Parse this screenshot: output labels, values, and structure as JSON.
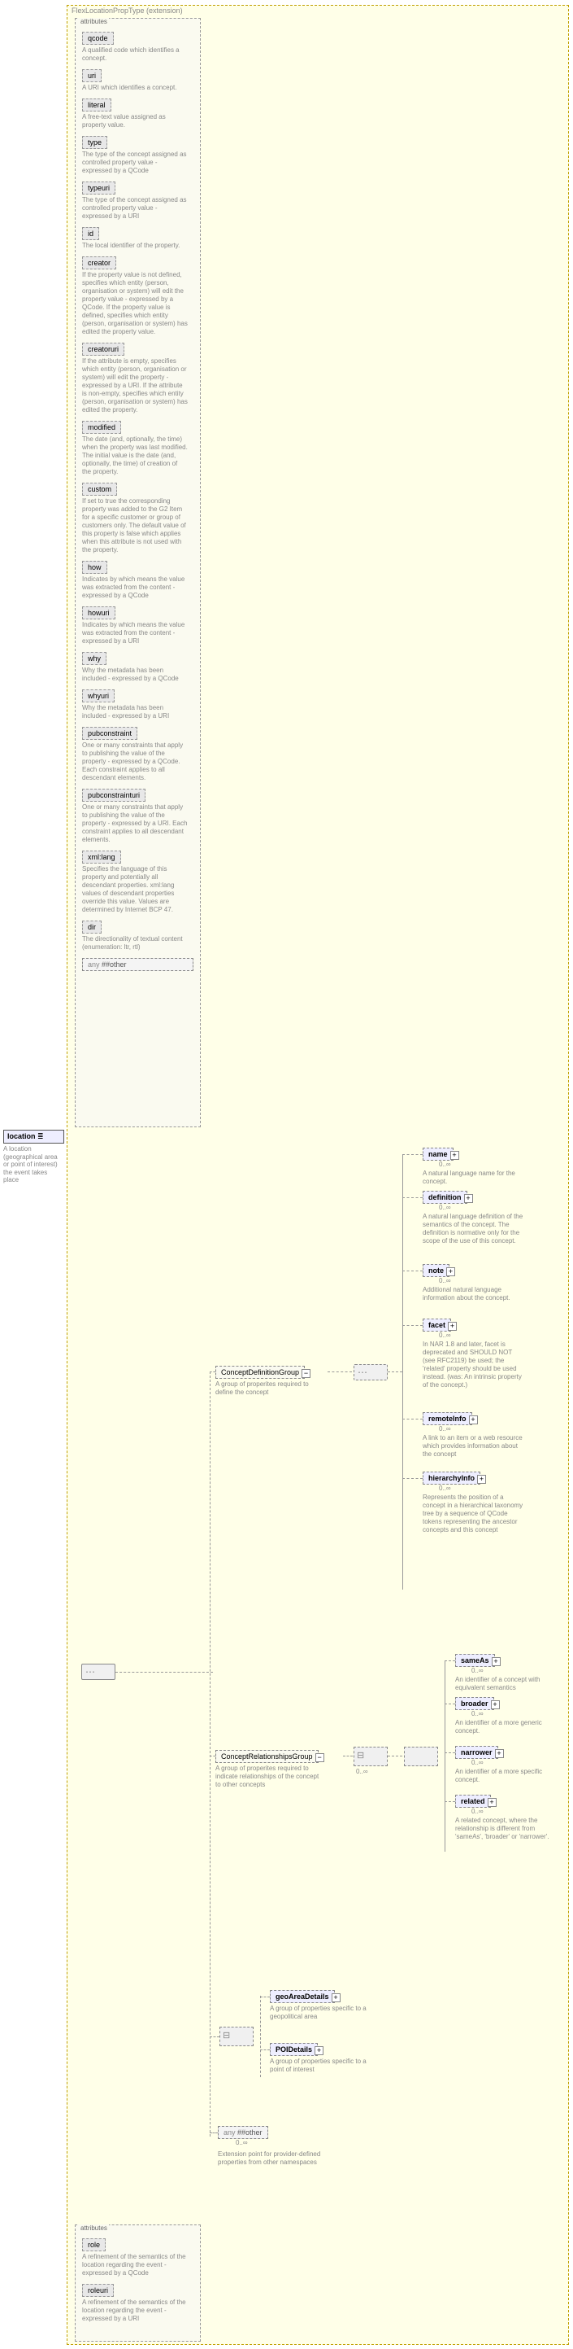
{
  "extension": {
    "label": "FlexLocationPropType (extension)"
  },
  "location": {
    "name": "location",
    "icon": "≣",
    "desc": "A location (geographical area or point of interest) the event takes place"
  },
  "attributes_label": "attributes",
  "attrs_top": [
    {
      "name": "qcode",
      "desc": "A qualified code which identifies a concept."
    },
    {
      "name": "uri",
      "desc": "A URI which identifies a concept."
    },
    {
      "name": "literal",
      "desc": "A free-text value assigned as property value."
    },
    {
      "name": "type",
      "desc": "The type of the concept assigned as controlled property value - expressed by a QCode"
    },
    {
      "name": "typeuri",
      "desc": "The type of the concept assigned as controlled property value - expressed by a URI"
    },
    {
      "name": "id",
      "desc": "The local identifier of the property."
    },
    {
      "name": "creator",
      "desc": "If the property value is not defined, specifies which entity (person, organisation or system) will edit the property value - expressed by a QCode. If the property value is defined, specifies which entity (person, organisation or system) has edited the property value."
    },
    {
      "name": "creatoruri",
      "desc": "If the attribute is empty, specifies which entity (person, organisation or system) will edit the property - expressed by a URI. If the attribute is non-empty, specifies which entity (person, organisation or system) has edited the property."
    },
    {
      "name": "modified",
      "desc": "The date (and, optionally, the time) when the property was last modified. The initial value is the date (and, optionally, the time) of creation of the property."
    },
    {
      "name": "custom",
      "desc": "If set to true the corresponding property was added to the G2 Item for a specific customer or group of customers only. The default value of this property is false which applies when this attribute is not used with the property."
    },
    {
      "name": "how",
      "desc": "Indicates by which means the value was extracted from the content - expressed by a QCode"
    },
    {
      "name": "howuri",
      "desc": "Indicates by which means the value was extracted from the content - expressed by a URI"
    },
    {
      "name": "why",
      "desc": "Why the metadata has been included - expressed by a QCode"
    },
    {
      "name": "whyuri",
      "desc": "Why the metadata has been included - expressed by a URI"
    },
    {
      "name": "pubconstraint",
      "desc": "One or many constraints that apply to publishing the value of the property - expressed by a QCode. Each constraint applies to all descendant elements."
    },
    {
      "name": "pubconstrainturi",
      "desc": "One or many constraints that apply to publishing the value of the property - expressed by a URI. Each constraint applies to all descendant elements."
    },
    {
      "name": "xml:lang",
      "desc": "Specifies the language of this property and potentially all descendant properties. xml:lang values of descendant properties override this value. Values are determined by Internet BCP 47."
    },
    {
      "name": "dir",
      "desc": "The directionality of textual content (enumeration: ltr, rtl)"
    }
  ],
  "attrs_bottom": [
    {
      "name": "role",
      "desc": "A refinement of the semantics of the location regarding the event - expressed by a QCode"
    },
    {
      "name": "roleuri",
      "desc": "A refinement of the semantics of the location regarding the event - expressed by a URI"
    }
  ],
  "any_attr": "##other",
  "groups": {
    "cdg": {
      "name": "ConceptDefinitionGroup",
      "desc": "A group of properites required to define the concept"
    },
    "crg": {
      "name": "ConceptRelationshipsGroup",
      "desc": "A group of properites required to indicate relationships of the concept to other concepts"
    }
  },
  "cdg_elems": [
    {
      "name": "name",
      "desc": "A natural language name for the concept."
    },
    {
      "name": "definition",
      "desc": "A natural language definition of the semantics of the concept. The definition is normative only for the scope of the use of this concept."
    },
    {
      "name": "note",
      "desc": "Additional natural language information about the concept."
    },
    {
      "name": "facet",
      "desc": "In NAR 1.8 and later, facet is deprecated and SHOULD NOT (see RFC2119) be used; the 'related' property should be used instead. (was: An intrinsic property of the concept.)"
    },
    {
      "name": "remoteInfo",
      "desc": "A link to an item or a web resource which provides information about the concept"
    },
    {
      "name": "hierarchyInfo",
      "desc": "Represents the position of a concept in a hierarchical taxonomy tree by a sequence of QCode tokens representing the ancestor concepts and this concept"
    }
  ],
  "crg_elems": [
    {
      "name": "sameAs",
      "desc": "An identifier of a concept with equivalent semantics"
    },
    {
      "name": "broader",
      "desc": "An identifier of a more generic concept."
    },
    {
      "name": "narrower",
      "desc": "An identifier of a more specific concept."
    },
    {
      "name": "related",
      "desc": "A related concept, where the relationship is different from 'sameAs', 'broader' or 'narrower'."
    }
  ],
  "details": [
    {
      "name": "geoAreaDetails",
      "desc": "A group of properties specific to a geopolitical area"
    },
    {
      "name": "POIDetails",
      "desc": "A group of properties specific to a point of interest"
    }
  ],
  "any_elem": {
    "name": "##other",
    "occurs": "0..∞",
    "desc": "Extension point for provider-defined properties from other namespaces"
  },
  "occurs_0inf": "0..∞"
}
